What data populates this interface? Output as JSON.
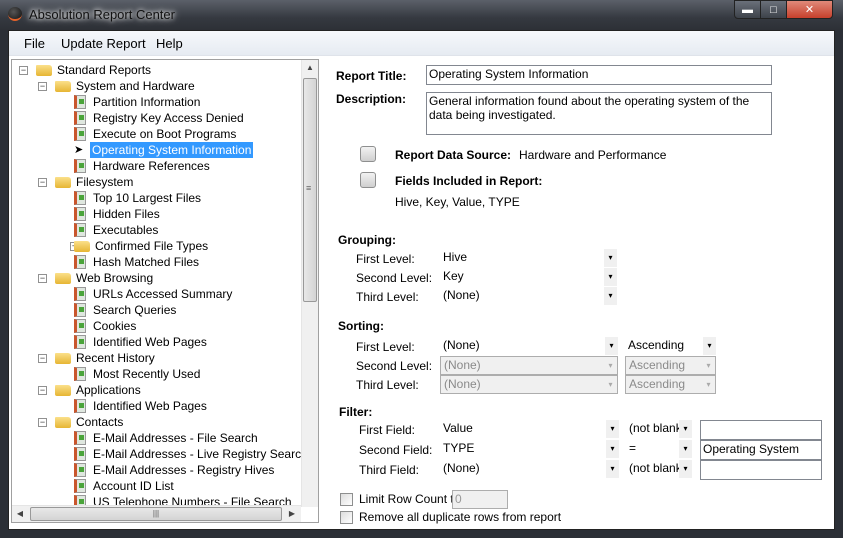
{
  "window": {
    "title": "Absolution Report Center",
    "minimize": "▬",
    "maximize": "□",
    "close": "✕"
  },
  "menu": [
    "File",
    "Update Report",
    "Help"
  ],
  "tree": [
    {
      "label": "Standard Reports",
      "level": 0,
      "type": "folder",
      "expander": "−"
    },
    {
      "label": "System and Hardware",
      "level": 1,
      "type": "folder",
      "expander": "−"
    },
    {
      "label": "Partition Information",
      "level": 2,
      "type": "report"
    },
    {
      "label": "Registry Key Access Denied",
      "level": 2,
      "type": "report"
    },
    {
      "label": "Execute on Boot Programs",
      "level": 2,
      "type": "report"
    },
    {
      "label": "Operating System Information",
      "level": 2,
      "type": "current",
      "selected": true
    },
    {
      "label": "Hardware References",
      "level": 2,
      "type": "report"
    },
    {
      "label": "Filesystem",
      "level": 1,
      "type": "folder",
      "expander": "−"
    },
    {
      "label": "Top 10 Largest Files",
      "level": 2,
      "type": "report"
    },
    {
      "label": "Hidden Files",
      "level": 2,
      "type": "report"
    },
    {
      "label": "Executables",
      "level": 2,
      "type": "report"
    },
    {
      "label": "Confirmed File Types",
      "level": 2,
      "type": "folder",
      "expander": "+"
    },
    {
      "label": "Hash Matched Files",
      "level": 2,
      "type": "report"
    },
    {
      "label": "Web Browsing",
      "level": 1,
      "type": "folder",
      "expander": "−"
    },
    {
      "label": "URLs Accessed Summary",
      "level": 2,
      "type": "report"
    },
    {
      "label": "Search Queries",
      "level": 2,
      "type": "report"
    },
    {
      "label": "Cookies",
      "level": 2,
      "type": "report"
    },
    {
      "label": "Identified Web Pages",
      "level": 2,
      "type": "report"
    },
    {
      "label": "Recent History",
      "level": 1,
      "type": "folder",
      "expander": "−"
    },
    {
      "label": "Most Recently Used",
      "level": 2,
      "type": "report"
    },
    {
      "label": "Applications",
      "level": 1,
      "type": "folder",
      "expander": "−"
    },
    {
      "label": "Identified Web Pages",
      "level": 2,
      "type": "report"
    },
    {
      "label": "Contacts",
      "level": 1,
      "type": "folder",
      "expander": "−"
    },
    {
      "label": "E-Mail Addresses - File Search",
      "level": 2,
      "type": "report"
    },
    {
      "label": "E-Mail Addresses - Live Registry Search",
      "level": 2,
      "type": "report"
    },
    {
      "label": "E-Mail Addresses - Registry Hives",
      "level": 2,
      "type": "report"
    },
    {
      "label": "Account ID List",
      "level": 2,
      "type": "report"
    },
    {
      "label": "US Telephone Numbers - File Search",
      "level": 2,
      "type": "report"
    }
  ],
  "scroll": {
    "up": "▲",
    "grip": "≡",
    "hgrip": "|||",
    "left": "◀",
    "right": "▶"
  },
  "report": {
    "title_label": "Report Title:",
    "title_value": "Operating System Information",
    "desc_label": "Description:",
    "desc_value": "General information found about the operating system of the data being investigated.",
    "source_label": "Report Data Source:",
    "source_value": "Hardware and Performance",
    "fields_label": "Fields Included in Report:",
    "fields_value": "Hive, Key, Value, TYPE"
  },
  "grouping": {
    "heading": "Grouping:",
    "rows": [
      {
        "label": "First Level:",
        "value": "Hive"
      },
      {
        "label": "Second Level:",
        "value": "Key"
      },
      {
        "label": "Third Level:",
        "value": "(None)"
      }
    ]
  },
  "sorting": {
    "heading": "Sorting:",
    "rows": [
      {
        "label": "First Level:",
        "value": "(None)",
        "order": "Ascending",
        "disabled": false
      },
      {
        "label": "Second Level:",
        "value": "(None)",
        "order": "Ascending",
        "disabled": true
      },
      {
        "label": "Third Level:",
        "value": "(None)",
        "order": "Ascending",
        "disabled": true
      }
    ]
  },
  "filter": {
    "heading": "Filter:",
    "rows": [
      {
        "label": "First Field:",
        "field": "Value",
        "op": "(not blank",
        "text": ""
      },
      {
        "label": "Second Field:",
        "field": "TYPE",
        "op": "=",
        "text": "Operating System"
      },
      {
        "label": "Third Field:",
        "field": "(None)",
        "op": "(not blank",
        "text": ""
      }
    ]
  },
  "options": {
    "limit_label": "Limit Row Count to",
    "limit_value": "0",
    "limit_checked": false,
    "dedupe_label": "Remove all duplicate rows from report",
    "dedupe_checked": false
  },
  "dropdown_glyph": "▾"
}
